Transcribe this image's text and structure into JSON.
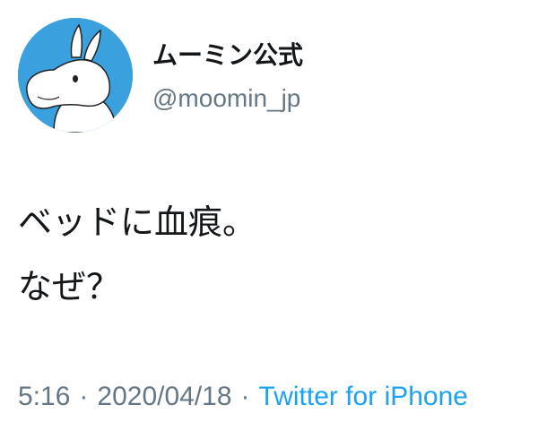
{
  "user": {
    "display_name": "ムーミン公式",
    "handle": "@moomin_jp",
    "avatar_icon": "moomin-avatar-icon",
    "avatar_color": "#3aa0de"
  },
  "tweet": {
    "lines": [
      "ベッドに血痕。",
      "なぜ？"
    ]
  },
  "meta": {
    "time": "5:16",
    "separator": "·",
    "date": "2020/04/18",
    "source": "Twitter for iPhone"
  },
  "colors": {
    "text": "#14171a",
    "secondary": "#657786",
    "link": "#1da1f2"
  }
}
